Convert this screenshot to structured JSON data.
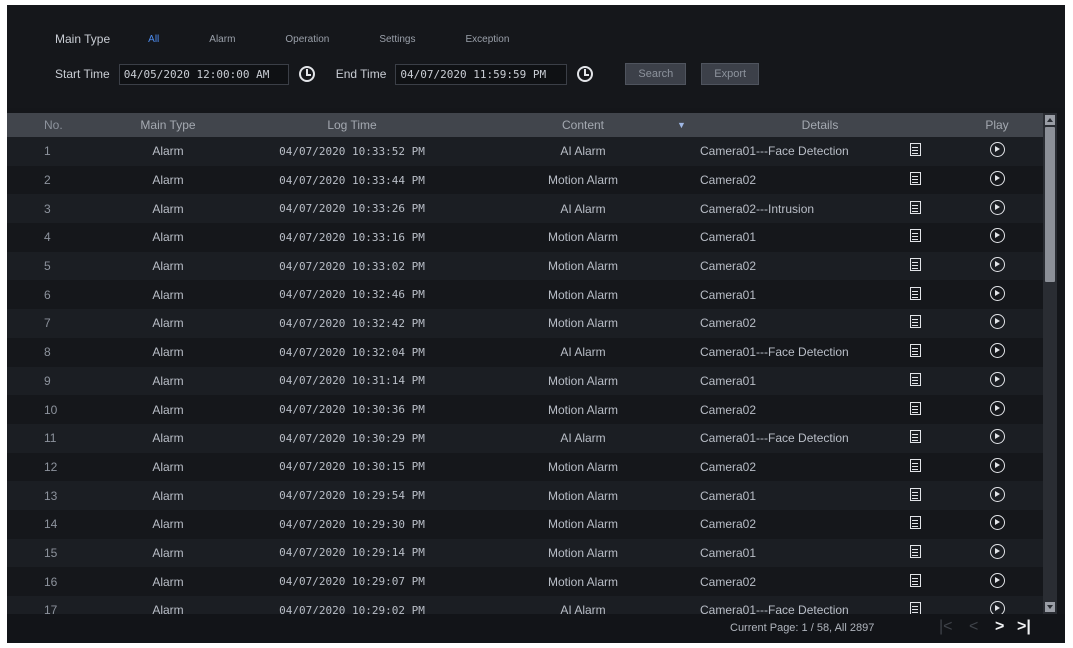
{
  "filter": {
    "main_type_label": "Main Type",
    "types": [
      "All",
      "Alarm",
      "Operation",
      "Settings",
      "Exception"
    ],
    "active_type": "All",
    "start_label": "Start Time",
    "start_value": "04/05/2020 12:00:00 AM",
    "end_label": "End Time",
    "end_value": "04/07/2020 11:59:59 PM",
    "search_label": "Search",
    "export_label": "Export"
  },
  "table": {
    "headers": {
      "no": "No.",
      "main_type": "Main Type",
      "log_time": "Log Time",
      "content": "Content",
      "details": "Details",
      "play": "Play"
    },
    "rows": [
      {
        "no": "1",
        "type": "Alarm",
        "time": "04/07/2020 10:33:52 PM",
        "content": "AI Alarm",
        "details": "Camera01---Face Detection"
      },
      {
        "no": "2",
        "type": "Alarm",
        "time": "04/07/2020 10:33:44 PM",
        "content": "Motion Alarm",
        "details": "Camera02"
      },
      {
        "no": "3",
        "type": "Alarm",
        "time": "04/07/2020 10:33:26 PM",
        "content": "AI Alarm",
        "details": "Camera02---Intrusion"
      },
      {
        "no": "4",
        "type": "Alarm",
        "time": "04/07/2020 10:33:16 PM",
        "content": "Motion Alarm",
        "details": "Camera01"
      },
      {
        "no": "5",
        "type": "Alarm",
        "time": "04/07/2020 10:33:02 PM",
        "content": "Motion Alarm",
        "details": "Camera02"
      },
      {
        "no": "6",
        "type": "Alarm",
        "time": "04/07/2020 10:32:46 PM",
        "content": "Motion Alarm",
        "details": "Camera01"
      },
      {
        "no": "7",
        "type": "Alarm",
        "time": "04/07/2020 10:32:42 PM",
        "content": "Motion Alarm",
        "details": "Camera02"
      },
      {
        "no": "8",
        "type": "Alarm",
        "time": "04/07/2020 10:32:04 PM",
        "content": "AI Alarm",
        "details": "Camera01---Face Detection"
      },
      {
        "no": "9",
        "type": "Alarm",
        "time": "04/07/2020 10:31:14 PM",
        "content": "Motion Alarm",
        "details": "Camera01"
      },
      {
        "no": "10",
        "type": "Alarm",
        "time": "04/07/2020 10:30:36 PM",
        "content": "Motion Alarm",
        "details": "Camera02"
      },
      {
        "no": "11",
        "type": "Alarm",
        "time": "04/07/2020 10:30:29 PM",
        "content": "AI Alarm",
        "details": "Camera01---Face Detection"
      },
      {
        "no": "12",
        "type": "Alarm",
        "time": "04/07/2020 10:30:15 PM",
        "content": "Motion Alarm",
        "details": "Camera02"
      },
      {
        "no": "13",
        "type": "Alarm",
        "time": "04/07/2020 10:29:54 PM",
        "content": "Motion Alarm",
        "details": "Camera01"
      },
      {
        "no": "14",
        "type": "Alarm",
        "time": "04/07/2020 10:29:30 PM",
        "content": "Motion Alarm",
        "details": "Camera02"
      },
      {
        "no": "15",
        "type": "Alarm",
        "time": "04/07/2020 10:29:14 PM",
        "content": "Motion Alarm",
        "details": "Camera01"
      },
      {
        "no": "16",
        "type": "Alarm",
        "time": "04/07/2020 10:29:07 PM",
        "content": "Motion Alarm",
        "details": "Camera02"
      },
      {
        "no": "17",
        "type": "Alarm",
        "time": "04/07/2020 10:29:02 PM",
        "content": "AI Alarm",
        "details": "Camera01---Face Detection"
      }
    ]
  },
  "footer": {
    "page_info": "Current Page: 1 / 58, All 2897",
    "first": "|<",
    "prev": "<",
    "next": ">",
    "last": ">|"
  },
  "colors": {
    "accent": "#4d8df0",
    "background": "#14161a",
    "header": "#41454c"
  }
}
